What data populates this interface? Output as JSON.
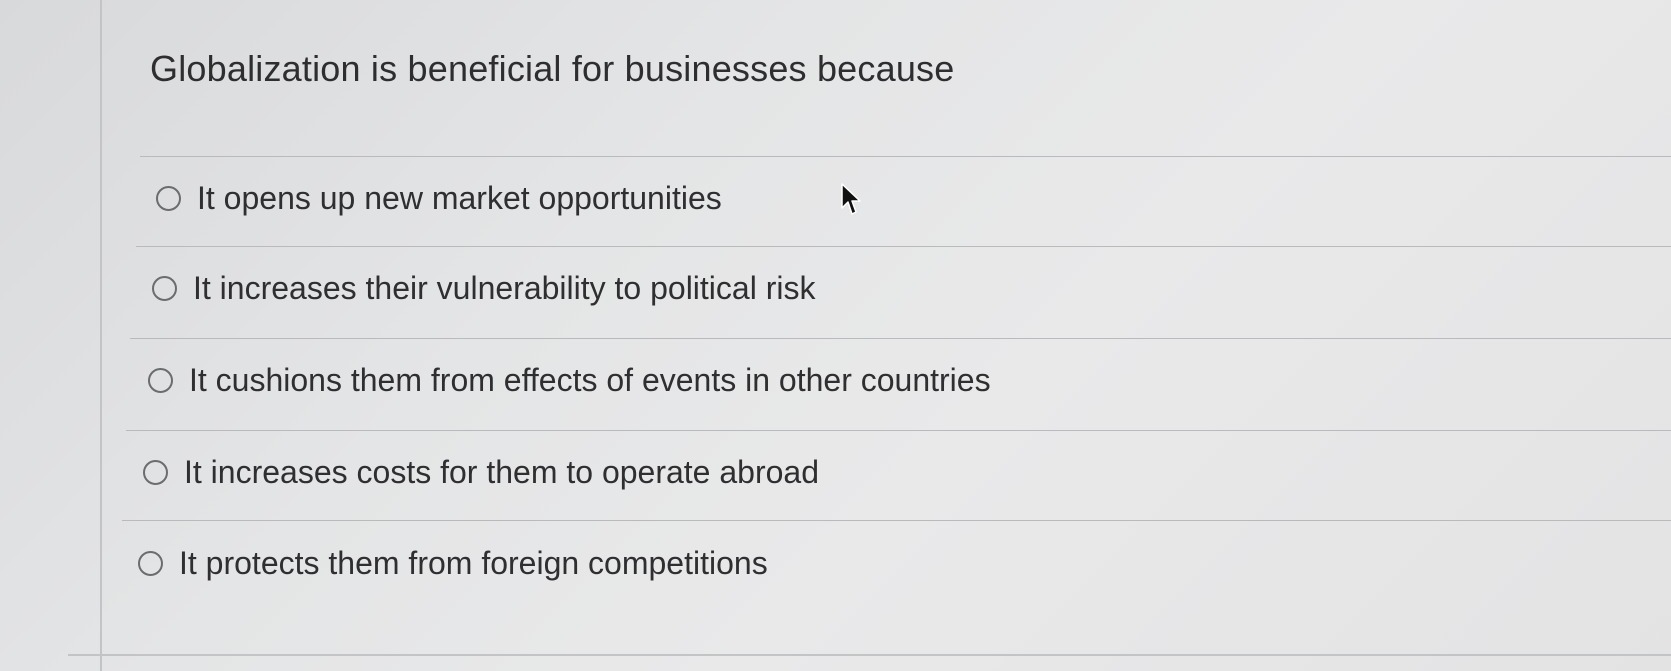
{
  "question": {
    "text": "Globalization is beneficial for businesses because"
  },
  "options": [
    {
      "label": "It opens up new market opportunities",
      "selected": false
    },
    {
      "label": "It increases their vulnerability to political risk",
      "selected": false
    },
    {
      "label": "It cushions them from effects of events in other countries",
      "selected": false
    },
    {
      "label": "It increases costs for them to operate abroad",
      "selected": false
    },
    {
      "label": "It protects them from foreign competitions",
      "selected": false
    }
  ],
  "icons": {
    "cursor": "mouse-pointer-icon",
    "option_control": "radio-button"
  }
}
